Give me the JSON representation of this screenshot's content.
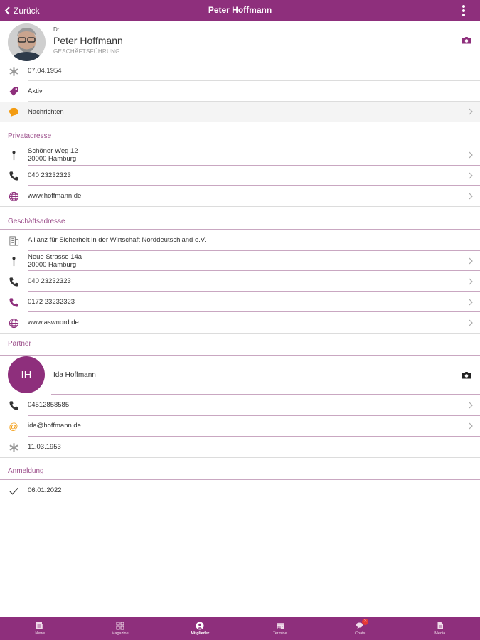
{
  "header": {
    "back_label": "Zurück",
    "title": "Peter Hoffmann"
  },
  "profile": {
    "title_prefix": "Dr.",
    "name": "Peter Hoffmann",
    "role": "GESCHÄFTSFÜHRUNG",
    "birthday": "07.04.1954",
    "status": "Aktiv",
    "messages": "Nachrichten"
  },
  "private_address": {
    "heading": "Privatadresse",
    "street": "Schöner Weg 12",
    "city": "20000 Hamburg",
    "phone": "040 23232323",
    "web": "www.hoffmann.de"
  },
  "business_address": {
    "heading": "Geschäftsadresse",
    "company": "Allianz für Sicherheit in der Wirtschaft Norddeutschland e.V.",
    "street": "Neue Strasse 14a",
    "city": "20000 Hamburg",
    "phone": "040 23232323",
    "mobile": "0172 23232323",
    "web": "www.aswnord.de"
  },
  "partner": {
    "heading": "Partner",
    "initials": "IH",
    "name": "Ida Hoffmann",
    "phone": "04512858585",
    "email": "ida@hoffmann.de",
    "birthday": "11.03.1953"
  },
  "registration": {
    "heading": "Anmeldung",
    "date": "06.01.2022"
  },
  "tabs": [
    {
      "label": "News",
      "icon": "news-icon"
    },
    {
      "label": "Magazine",
      "icon": "grid-icon"
    },
    {
      "label": "Mitglieder",
      "icon": "person-circle-icon"
    },
    {
      "label": "Termine",
      "icon": "calendar-icon"
    },
    {
      "label": "Chats",
      "icon": "chat-bubbles-icon",
      "badge": "3"
    },
    {
      "label": "Media",
      "icon": "document-icon"
    }
  ],
  "colors": {
    "brand": "#8e2f7c",
    "section_heading": "#9c4f8b",
    "badge": "#e53935",
    "messages_icon": "#f39c12"
  }
}
